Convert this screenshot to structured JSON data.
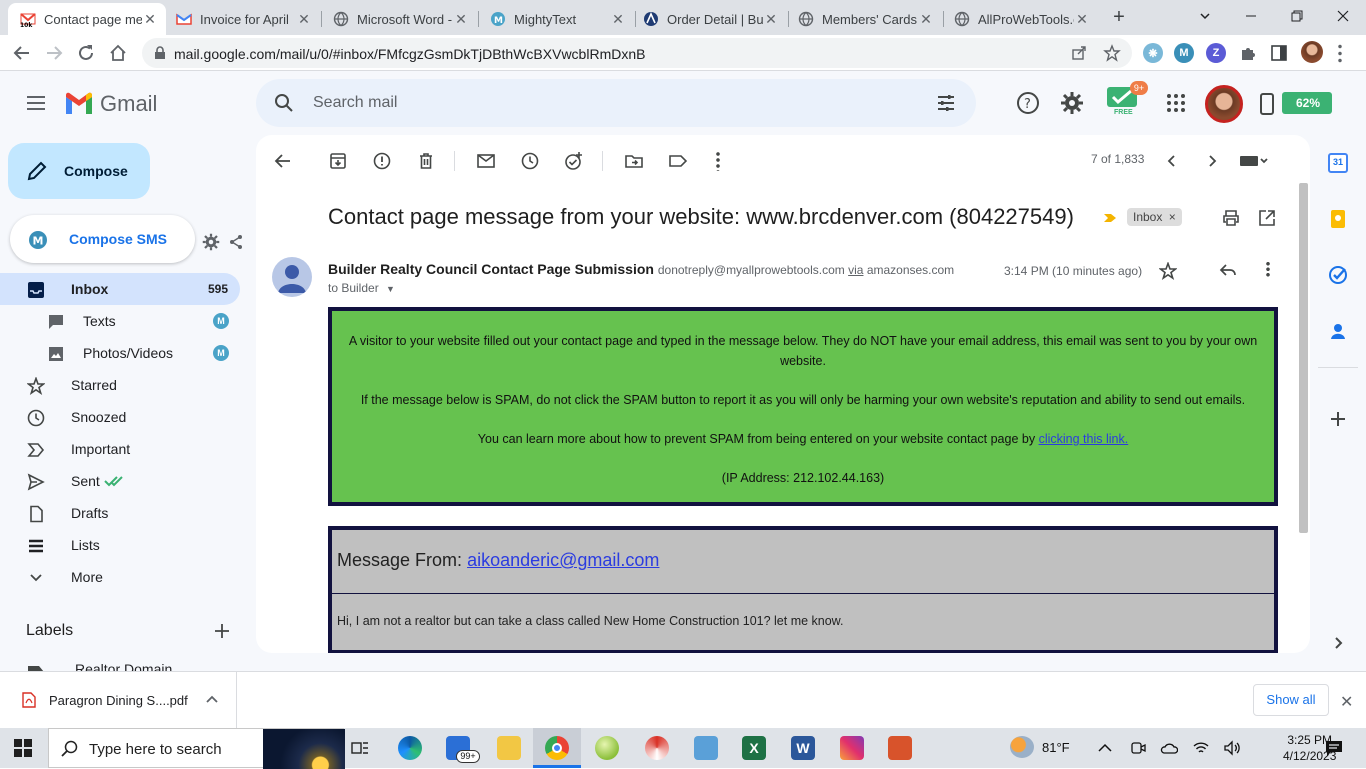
{
  "browser": {
    "tabs": [
      {
        "title": "Contact page me",
        "icon": "gmail-10k-icon",
        "active": true
      },
      {
        "title": "Invoice for April",
        "icon": "gmail-icon",
        "active": false
      },
      {
        "title": "Microsoft Word -",
        "icon": "globe-icon",
        "active": false
      },
      {
        "title": "MightyText",
        "icon": "mightytext-icon",
        "active": false
      },
      {
        "title": "Order Detail | Bu",
        "icon": "order-icon",
        "active": false
      },
      {
        "title": "Members' Cards",
        "icon": "globe-icon",
        "active": false
      },
      {
        "title": "AllProWebTools.c",
        "icon": "globe-icon",
        "active": false
      }
    ],
    "url": "mail.google.com/mail/u/0/#inbox/FMfcgzGsmDkTjDBthWcBXVwcblRmDxnB"
  },
  "gmail": {
    "brand": "Gmail",
    "search_placeholder": "Search mail",
    "free_badge": "FREE",
    "notification_count": "9+",
    "battery": "62%",
    "compose_label": "Compose",
    "compose_sms_label": "Compose SMS",
    "nav": [
      {
        "label": "Inbox",
        "count": "595",
        "icon": "inbox-icon",
        "active": true
      },
      {
        "label": "Texts",
        "icon": "chat-icon",
        "badge": "M"
      },
      {
        "label": "Photos/Videos",
        "icon": "image-icon",
        "badge": "M"
      },
      {
        "label": "Starred",
        "icon": "star-icon"
      },
      {
        "label": "Snoozed",
        "icon": "clock-icon"
      },
      {
        "label": "Important",
        "icon": "important-icon"
      },
      {
        "label": "Sent",
        "icon": "send-icon"
      },
      {
        "label": "Drafts",
        "icon": "draft-icon"
      },
      {
        "label": "Lists",
        "icon": "list-icon"
      },
      {
        "label": "More",
        "icon": "chevron-down-icon"
      }
    ],
    "labels_heading": "Labels",
    "labels": [
      "Realtor Domain"
    ]
  },
  "message": {
    "paging": "7 of 1,833",
    "subject": "Contact page message from your website: www.brcdenver.com (804227549)",
    "inbox_chip": "Inbox",
    "sender_name": "Builder Realty Council Contact Page Submission",
    "sender_email": "donotreply@myallprowebtools.com",
    "via_label": "via",
    "via_domain": "amazonses.com",
    "recipients": "to Builder",
    "time": "3:14 PM (10 minutes ago)",
    "notice_1": "A visitor to your website filled out your contact page and typed in the message below. They do NOT have your email address, this email was sent to you by your own website.",
    "notice_2": "If the message below is SPAM, do not click the SPAM button to report it as you will only be harming your own website's reputation and ability to send out emails.",
    "notice_3": "You can learn more about how to prevent SPAM from being entered on your website contact page by",
    "notice_link": "clicking this link.",
    "ip_address": "(IP Address: 212.102.44.163)",
    "from_label": "Message From:",
    "from_email": "aikoanderic@gmail.com",
    "body": "Hi, I am not a realtor but can take a class called New Home Construction 101? let me know."
  },
  "downloads": {
    "file": "Paragron Dining S....pdf",
    "show_all": "Show all"
  },
  "taskbar": {
    "search_placeholder": "Type here to search",
    "mail_badge": "99+",
    "weather": "81°F",
    "time": "3:25 PM",
    "date": "4/12/2023"
  },
  "colors": {
    "notice_green": "#66c24f",
    "message_grey": "#c0c0c0",
    "border_navy": "#12123f",
    "link_blue": "#2b3ce0"
  }
}
